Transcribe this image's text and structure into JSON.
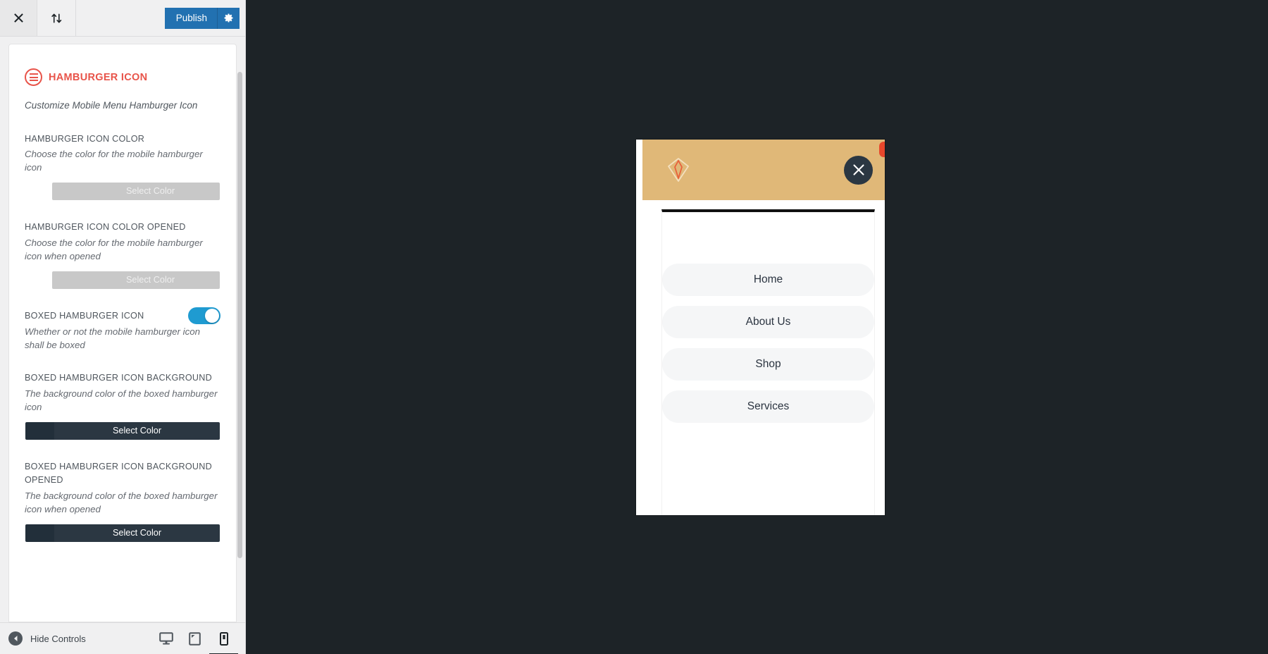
{
  "customizer": {
    "header": {
      "close_icon": "close-x-icon",
      "devices_icon": "sort-arrows-icon",
      "publish_label": "Publish",
      "publish_settings_icon": "gear-icon"
    },
    "section": {
      "icon": "hamburger-circle-icon",
      "title": "HAMBURGER ICON",
      "description": "Customize Mobile Menu Hamburger Icon"
    },
    "controls": [
      {
        "label": "HAMBURGER ICON COLOR",
        "description": "Choose the color for the mobile hamburger icon",
        "button_label": "Select Color",
        "state": "disabled",
        "swatch_color": "#c8c8c8",
        "button_color": "#c8c8c8"
      },
      {
        "label": "HAMBURGER ICON COLOR OPENED",
        "description": "Choose the color for the mobile hamburger icon when opened",
        "button_label": "Select Color",
        "state": "disabled",
        "swatch_color": "#c8c8c8",
        "button_color": "#c8c8c8"
      },
      {
        "label": "BOXED HAMBURGER ICON",
        "description": "Whether or not the mobile hamburger icon shall be boxed",
        "toggle": "on",
        "toggle_color": "#1f9bd1"
      },
      {
        "label": "BOXED HAMBURGER ICON BACKGROUND",
        "description": "The background color of the boxed hamburger icon",
        "button_label": "Select Color",
        "state": "active",
        "swatch_color": "#222f3a",
        "button_color": "#2b3742"
      },
      {
        "label": "BOXED HAMBURGER ICON BACKGROUND OPENED",
        "description": "The background color of the boxed hamburger icon when opened",
        "button_label": "Select Color",
        "state": "active",
        "swatch_color": "#222f3a",
        "button_color": "#2b3742"
      }
    ],
    "footer": {
      "collapse_icon": "collapse-left-icon",
      "hide_controls_label": "Hide Controls",
      "devices": [
        {
          "name": "desktop",
          "icon": "desktop-icon",
          "active": false
        },
        {
          "name": "tablet",
          "icon": "tablet-icon",
          "active": false
        },
        {
          "name": "mobile",
          "icon": "mobile-icon",
          "active": true
        }
      ]
    }
  },
  "preview": {
    "device": "mobile",
    "site_header": {
      "background_color": "#e0b878",
      "logo_icon": "diamond-gem-logo-icon",
      "close_button_icon": "close-x-icon",
      "close_button_background": "#2b3742",
      "notification_dot_color": "#e8472b"
    },
    "menu": {
      "items": [
        {
          "label": "Home"
        },
        {
          "label": "About Us"
        },
        {
          "label": "Shop"
        },
        {
          "label": "Services"
        }
      ],
      "item_background": "#f5f6f7",
      "item_text_color": "#2b3440"
    }
  }
}
